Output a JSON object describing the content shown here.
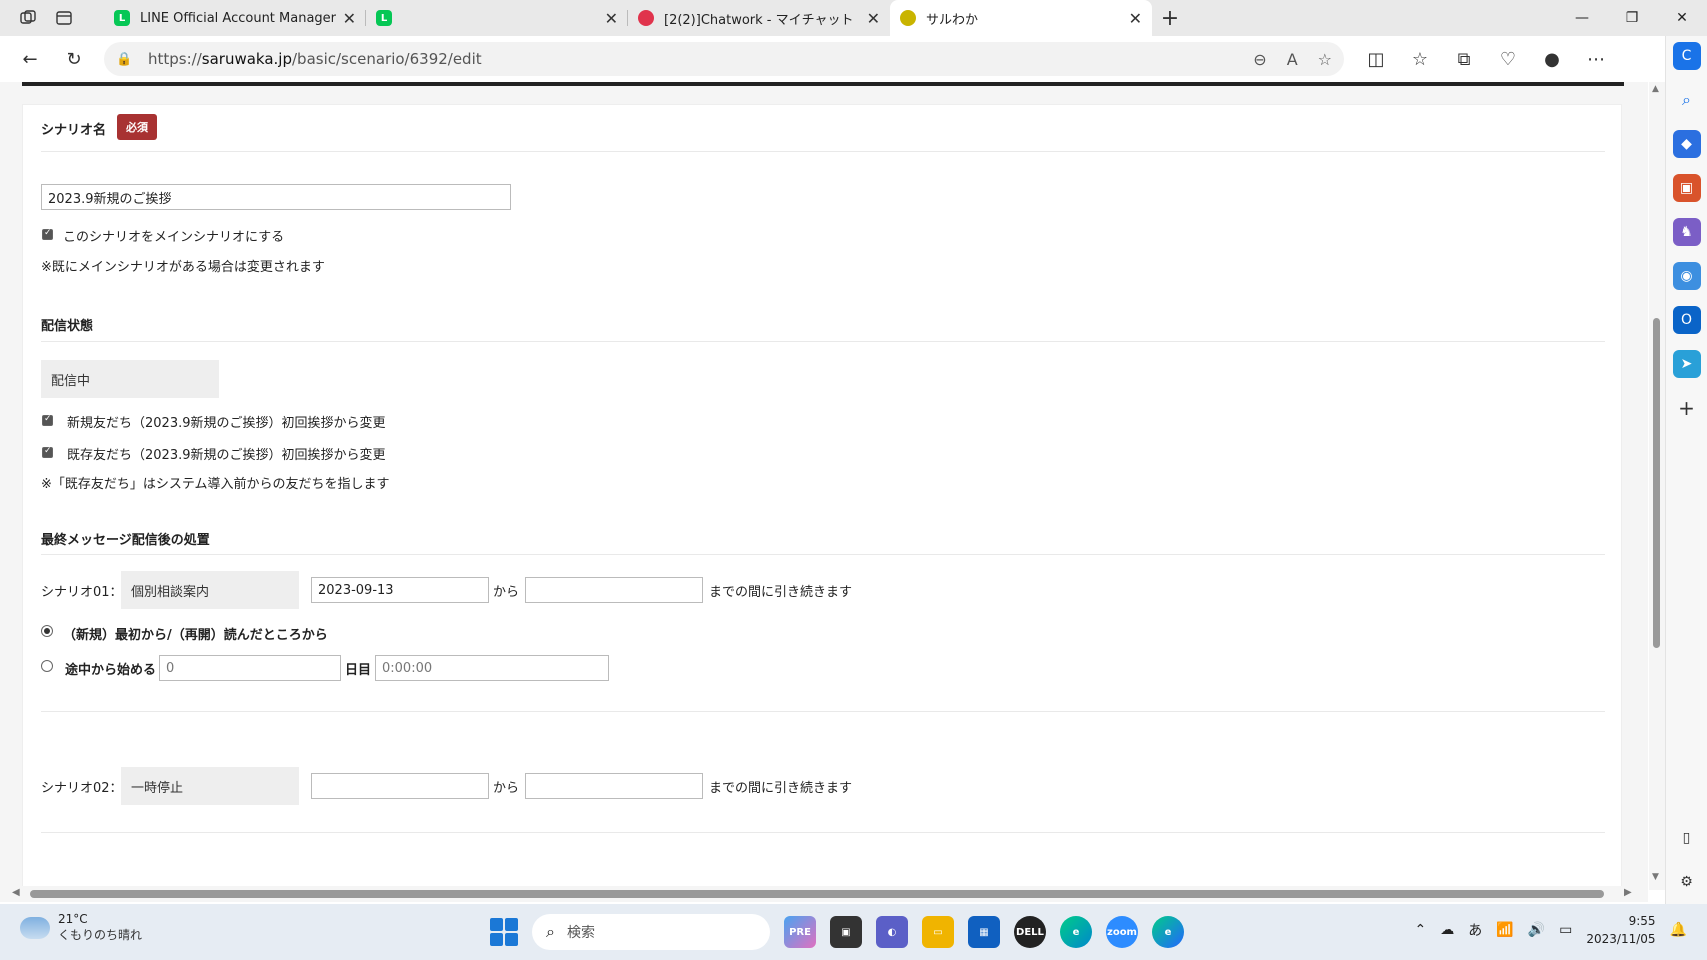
{
  "browser": {
    "tabs": [
      {
        "title": "LINE Official Account Manager",
        "favicon": "line-icon",
        "color": "#06c755"
      },
      {
        "title": "",
        "favicon": "line-icon",
        "color": "#06c755"
      },
      {
        "title": "[2(2)]Chatwork - マイチャット",
        "favicon": "chatwork-icon",
        "color": "#e0334c"
      },
      {
        "title": "サルわか",
        "favicon": "saruwaka-icon",
        "color": "#c9b400"
      }
    ],
    "url_prefix": "https://",
    "url_domain": "saruwaka.jp",
    "url_path": "/basic/scenario/6392/edit"
  },
  "form": {
    "scenario_name_label": "シナリオ名",
    "required_badge": "必須",
    "scenario_name_value": "2023.9新規のご挨拶",
    "main_scenario_checkbox": "このシナリオをメインシナリオにする",
    "main_scenario_note": "※既にメインシナリオがある場合は変更されます",
    "delivery_status_label": "配信状態",
    "delivery_status_value": "配信中",
    "new_friends_checkbox": "新規友だち（2023.9新規のご挨拶）初回挨拶から変更",
    "existing_friends_checkbox": "既存友だち（2023.9新規のご挨拶）初回挨拶から変更",
    "existing_note": "※「既存友だち」はシステム導入前からの友だちを指します",
    "after_last_label": "最終メッセージ配信後の処置",
    "scenario01_label": "シナリオ01：",
    "scenario01_value": "個別相談案内",
    "scenario01_from": "2023-09-13",
    "scenario01_to": "",
    "from_text": "から",
    "until_text": "までの間に引き続きます",
    "radio_restart": "（新規）最初から/（再開）読んだところから",
    "radio_middle": "途中から始める",
    "middle_day": "0",
    "day_text": "日目",
    "middle_time": "0:00:00",
    "scenario02_label": "シナリオ02：",
    "scenario02_value": "一時停止",
    "scenario02_from": "",
    "scenario02_to": ""
  },
  "taskbar": {
    "temperature": "21°C",
    "weather": "くもりのち晴れ",
    "search_placeholder": "検索",
    "time": "9:55",
    "date": "2023/11/05",
    "ime": "あ"
  }
}
